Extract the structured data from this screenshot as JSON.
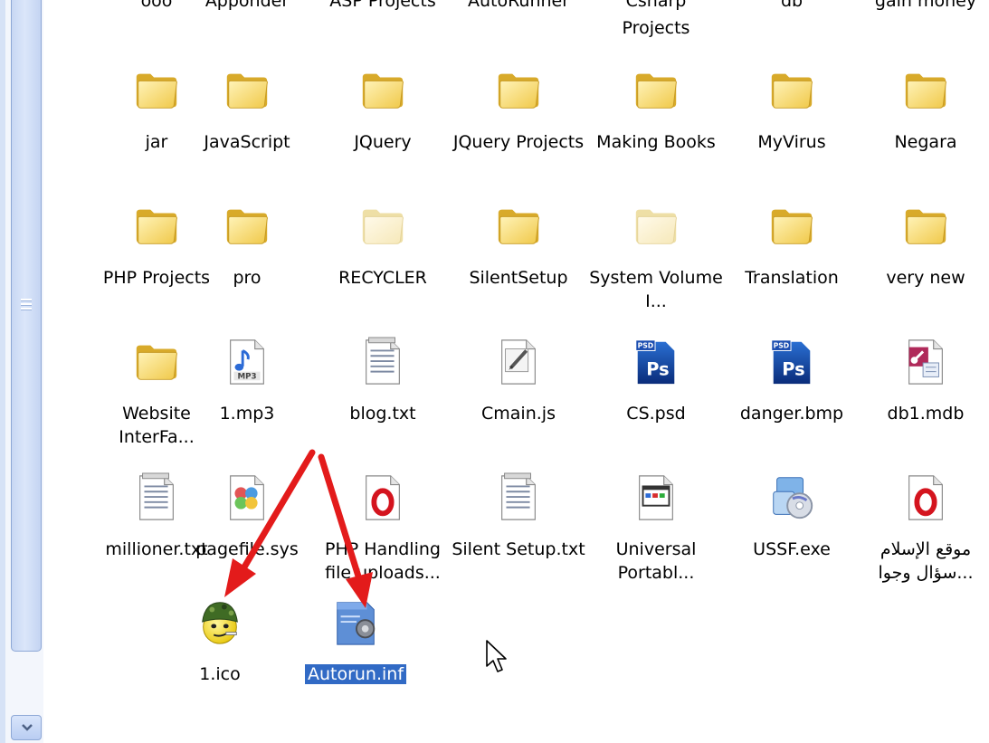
{
  "top_row_partial": [
    "ooo",
    "Apponder",
    "ASP Projects",
    "AutoRunner",
    "Csharp",
    "db",
    "gain money"
  ],
  "top_row_extra": "Projects",
  "items": [
    {
      "label": "jar",
      "icon": "folder-icon"
    },
    {
      "label": "JavaScript",
      "icon": "folder-icon"
    },
    {
      "label": "JQuery",
      "icon": "folder-icon"
    },
    {
      "label": "JQuery Projects",
      "icon": "folder-icon"
    },
    {
      "label": "Making Books",
      "icon": "folder-icon"
    },
    {
      "label": "MyVirus",
      "icon": "folder-icon"
    },
    {
      "label": "Negara",
      "icon": "folder-icon"
    },
    {
      "label": "PHP Projects",
      "icon": "folder-icon"
    },
    {
      "label": "pro",
      "icon": "folder-icon"
    },
    {
      "label": "RECYCLER",
      "icon": "hidden-folder-icon"
    },
    {
      "label": "SilentSetup",
      "icon": "folder-icon"
    },
    {
      "label": "System Volume I...",
      "icon": "hidden-folder-icon"
    },
    {
      "label": "Translation",
      "icon": "folder-icon"
    },
    {
      "label": "very new",
      "icon": "folder-icon"
    },
    {
      "label": "Website InterFa...",
      "icon": "folder-icon"
    },
    {
      "label": "1.mp3",
      "icon": "mp3-file-icon"
    },
    {
      "label": "blog.txt",
      "icon": "text-file-icon"
    },
    {
      "label": "Cmain.js",
      "icon": "script-file-icon"
    },
    {
      "label": "CS.psd",
      "icon": "photoshop-file-icon"
    },
    {
      "label": "danger.bmp",
      "icon": "photoshop-file-icon"
    },
    {
      "label": "db1.mdb",
      "icon": "access-database-icon"
    },
    {
      "label": "millioner.txt",
      "icon": "text-file-icon"
    },
    {
      "label": "pagefile.sys",
      "icon": "system-file-icon"
    },
    {
      "label": "PHP Handling file uploads...",
      "icon": "opera-html-icon"
    },
    {
      "label": "Silent Setup.txt",
      "icon": "text-file-icon"
    },
    {
      "label": "Universal Portabl...",
      "icon": "html-page-icon"
    },
    {
      "label": "USSF.exe",
      "icon": "installer-exe-icon"
    },
    {
      "label": "موقع الإسلام سؤال وجوا...",
      "icon": "opera-html-icon"
    },
    {
      "label": "1.ico",
      "icon": "smiley-soldier-icon"
    },
    {
      "label": "Autorun.inf",
      "icon": "config-file-icon",
      "selected": true
    }
  ],
  "colors": {
    "selection": "#316ac5",
    "arrow": "#e31b1b",
    "folder": "#f3d36a"
  }
}
